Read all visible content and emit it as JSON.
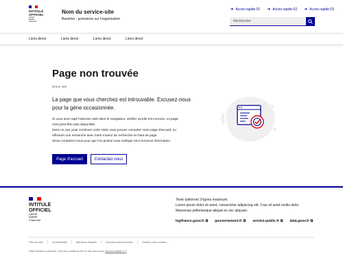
{
  "colors": {
    "blue_france": "#000091",
    "red_marianne": "#e1000f",
    "grey_text": "#666666"
  },
  "logo": {
    "title_line1": "INTITULÉ",
    "title_line2": "OFFICIEL",
    "motto_line1": "Liberté",
    "motto_line2": "Égalité",
    "motto_line3": "Fraternité"
  },
  "header": {
    "service_name": "Nom du service-site",
    "tagline": "Baseline - précisions sur l'organisation",
    "quick_links": [
      {
        "label": "Accès rapide 01",
        "icon": "arrow-right-icon"
      },
      {
        "label": "Accès rapide 02",
        "icon": "arrow-right-icon"
      },
      {
        "label": "Accès rapide 03",
        "icon": "arrow-right-icon"
      }
    ],
    "search": {
      "placeholder": "Rechercher",
      "icon": "search-icon"
    }
  },
  "nav": {
    "items": [
      "Liens direct",
      "Liens direct",
      "Liens direct",
      "Liens direct"
    ]
  },
  "main": {
    "title": "Page non trouvée",
    "error_code": "Erreur 404",
    "lead_line1": "La page que vous cherchez est introuvable. Excusez-nous",
    "lead_line2": "pour la gène occasionnée.",
    "body_line1": "Si vous avez tapé l'adresse web dans le navigateur, vérifiez qu'elle  est correcte. La page",
    "body_line2": "n'est peut-être plus disponible.",
    "body_line3": "Dans ce cas, pour continuer votre visite vous pouvez consulter notre page d'accueil, ou",
    "body_line4": "effectuer une recherche avec notre moteur de recherche en haut de page.",
    "body_line5": "Sinon contactez-nous pour que l'on puisse vous rediriger vers la bonne information.",
    "primary_button": "Page d'accueil",
    "secondary_button": "Contactez-nous",
    "illustration_icon": "technical-error-illustration-icon"
  },
  "footer": {
    "desc_line1": "Texte optionnel 3 lignes maximum.",
    "desc_line2": "Lorem ipsum dolor sit amet, consectetur adipiscing elit. Cras sit amet mollis dolor.",
    "desc_line3": "Maecenas pellentesque aliquet ex nec aliquam.",
    "links": [
      "legifrance.gouv.fr",
      "gouvernement.fr",
      "service-public.fr",
      "data.gouv.fr"
    ],
    "external_icon": "external-link-icon",
    "bottom_links": [
      "Plan du site",
      "Accessibilité",
      "Mentions légales",
      "Données personnelles",
      "Gestion des cookies"
    ],
    "license_text": "Sauf mention contraire, tous les contenus de ce site sont sous ",
    "license_link": "licence etalab-2.0"
  }
}
